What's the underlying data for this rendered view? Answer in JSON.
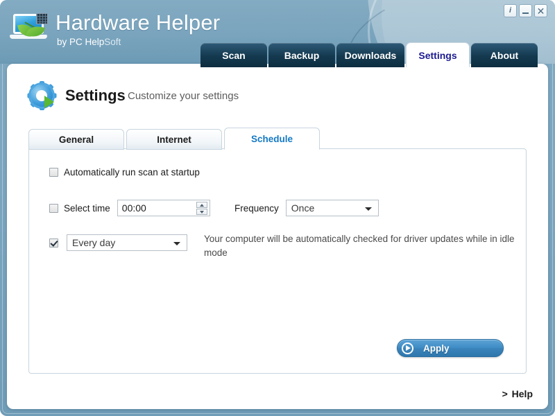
{
  "window": {
    "brand_title": "Hardware Helper",
    "brand_sub_prefix": "by PC Help",
    "brand_sub_suffix": "Soft",
    "logo_icon": "laptop-leaf-chip-icon",
    "controls": [
      {
        "name": "info-button",
        "label": "i"
      },
      {
        "name": "minimize-button",
        "label": ""
      },
      {
        "name": "close-button",
        "label": "✕"
      }
    ],
    "accent_header": "#7aa4bd",
    "accent_tab_dark": "#14394f",
    "accent_active_text": "#1b1a8f"
  },
  "top_tabs": [
    {
      "label": "Scan",
      "active": false
    },
    {
      "label": "Backup",
      "active": false
    },
    {
      "label": "Downloads",
      "active": false
    },
    {
      "label": "Settings",
      "active": true
    },
    {
      "label": "About",
      "active": false
    }
  ],
  "page": {
    "icon": "gear-play-icon",
    "title": "Settings",
    "subtitle": "Customize your settings"
  },
  "sub_tabs": [
    {
      "label": "General",
      "active": false
    },
    {
      "label": "Internet",
      "active": false
    },
    {
      "label": "Schedule",
      "active": true
    }
  ],
  "form": {
    "auto_scan": {
      "label": "Automatically run scan at startup",
      "checked": false
    },
    "select_time": {
      "label": "Select time",
      "checked": false,
      "value": "00:00",
      "spin_up_icon": "arrow-up-icon",
      "spin_down_icon": "arrow-down-icon"
    },
    "frequency": {
      "label": "Frequency",
      "value": "Once",
      "caret_icon": "chevron-down-icon"
    },
    "interval": {
      "checked": true,
      "value": "Every day",
      "caret_icon": "chevron-down-icon"
    },
    "description": "Your computer will be automatically checked for driver updates while in idle mode"
  },
  "apply_button": {
    "label": "Apply",
    "icon": "arrow-right-circle-icon",
    "color": "#3a84bb"
  },
  "help_link": {
    "chevron": ">",
    "label": "Help"
  }
}
